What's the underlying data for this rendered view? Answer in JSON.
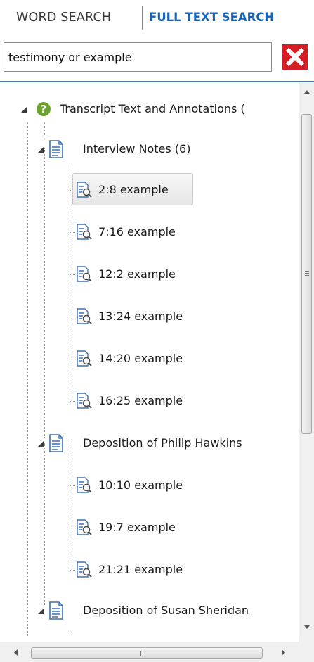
{
  "tabs": [
    {
      "label": "WORD SEARCH",
      "active": false
    },
    {
      "label": "FULL TEXT SEARCH",
      "active": true
    }
  ],
  "search": {
    "value": "testimony or example"
  },
  "clear_button": {
    "icon": "close-icon",
    "color": "#d51e24"
  },
  "tree": {
    "root": {
      "label": "Transcript Text and Annotations (",
      "icon": "help-icon",
      "expanded": true
    },
    "groups": [
      {
        "label": "Interview Notes (6)",
        "icon": "document-icon",
        "expanded": true,
        "results": [
          "2:8 example",
          "7:16 example",
          "12:2 example",
          "13:24 example",
          "14:20 example",
          "16:25 example"
        ]
      },
      {
        "label": "Deposition of Philip Hawkins",
        "icon": "document-icon",
        "expanded": true,
        "results": [
          "10:10 example",
          "19:7 example",
          "21:21 example"
        ]
      },
      {
        "label": "Deposition of Susan Sheridan",
        "icon": "document-icon",
        "expanded": true,
        "results": []
      }
    ],
    "selected": "2:8 example"
  },
  "scrollbar": {
    "h_grip": "III"
  },
  "colors": {
    "accent": "#1464b8",
    "divider": "#3f79c6",
    "help": "#6aa42f"
  }
}
